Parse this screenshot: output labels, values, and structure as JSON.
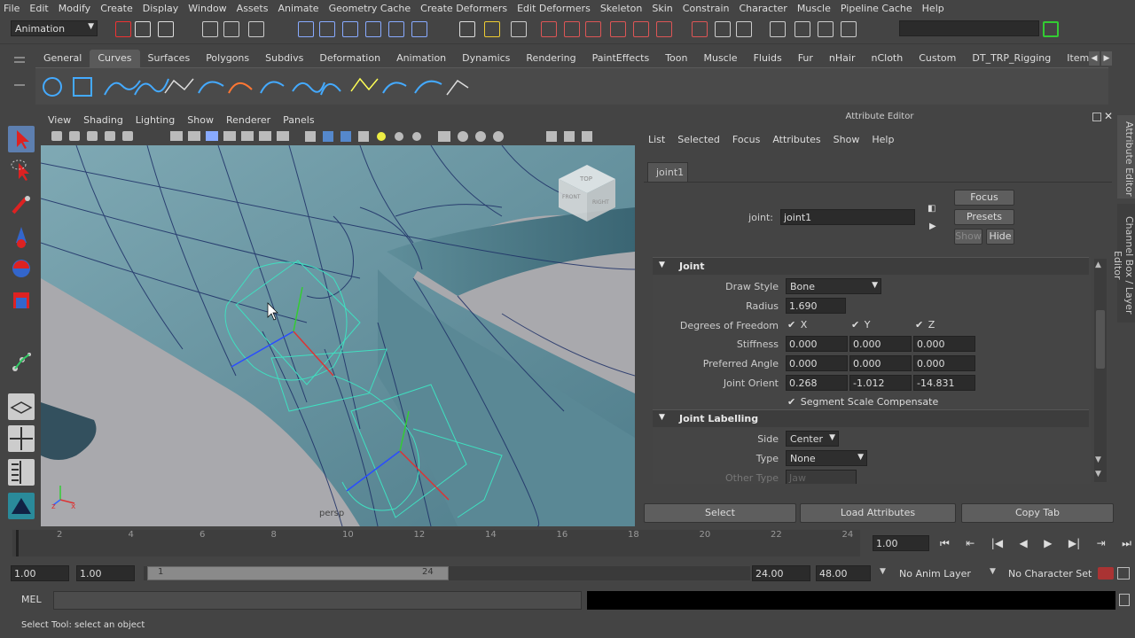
{
  "menubar": [
    "File",
    "Edit",
    "Modify",
    "Create",
    "Display",
    "Window",
    "Assets",
    "Animate",
    "Geometry Cache",
    "Create Deformers",
    "Edit Deformers",
    "Skeleton",
    "Skin",
    "Constrain",
    "Character",
    "Muscle",
    "Pipeline Cache",
    "Help"
  ],
  "mode_selector": "Animation",
  "shelf_tabs": [
    "General",
    "Curves",
    "Surfaces",
    "Polygons",
    "Subdivs",
    "Deformation",
    "Animation",
    "Dynamics",
    "Rendering",
    "PaintEffects",
    "Toon",
    "Muscle",
    "Fluids",
    "Fur",
    "nHair",
    "nCloth",
    "Custom",
    "DT_TRP_Rigging",
    "Item"
  ],
  "shelf_active": "Curves",
  "viewport_menu": [
    "View",
    "Shading",
    "Lighting",
    "Show",
    "Renderer",
    "Panels"
  ],
  "viewport": {
    "camera_label": "persp",
    "viewcube_top": "TOP",
    "viewcube_front": "FRONT",
    "viewcube_right": "RIGHT"
  },
  "attribute_editor": {
    "title": "Attribute Editor",
    "menu": [
      "List",
      "Selected",
      "Focus",
      "Attributes",
      "Show",
      "Help"
    ],
    "tab": "joint1",
    "node_label": "joint:",
    "node_value": "joint1",
    "btn_focus": "Focus",
    "btn_presets": "Presets",
    "btn_show": "Show",
    "btn_hide": "Hide",
    "joint_section": "Joint",
    "draw_style_label": "Draw Style",
    "draw_style_value": "Bone",
    "radius_label": "Radius",
    "radius_value": "1.690",
    "dof_label": "Degrees of Freedom",
    "dof_x": "X",
    "dof_y": "Y",
    "dof_z": "Z",
    "stiffness_label": "Stiffness",
    "stiffness": [
      "0.000",
      "0.000",
      "0.000"
    ],
    "preferred_label": "Preferred Angle",
    "preferred": [
      "0.000",
      "0.000",
      "0.000"
    ],
    "orient_label": "Joint Orient",
    "orient": [
      "0.268",
      "-1.012",
      "-14.831"
    ],
    "segment_scale": "Segment Scale Compensate",
    "labelling_section": "Joint Labelling",
    "side_label": "Side",
    "side_value": "Center",
    "type_label": "Type",
    "type_value": "None",
    "other_type_label": "Other Type",
    "other_type_value": "Jaw",
    "btn_select": "Select",
    "btn_load": "Load Attributes",
    "btn_copy": "Copy Tab"
  },
  "side_tabs": {
    "attr": "Attribute Editor",
    "channel": "Channel Box / Layer Editor"
  },
  "timeline": {
    "ticks": [
      "2",
      "4",
      "6",
      "8",
      "10",
      "12",
      "14",
      "16",
      "18",
      "20",
      "22",
      "24"
    ],
    "current": "1.00"
  },
  "range": {
    "start": "1.00",
    "playback_start": "1.00",
    "slider_start": "1",
    "slider_end": "24",
    "playback_end": "24.00",
    "end": "48.00",
    "anim_layer": "No Anim Layer",
    "char_set": "No Character Set"
  },
  "cmd": {
    "label": "MEL"
  },
  "help_line": "Select Tool: select an object"
}
